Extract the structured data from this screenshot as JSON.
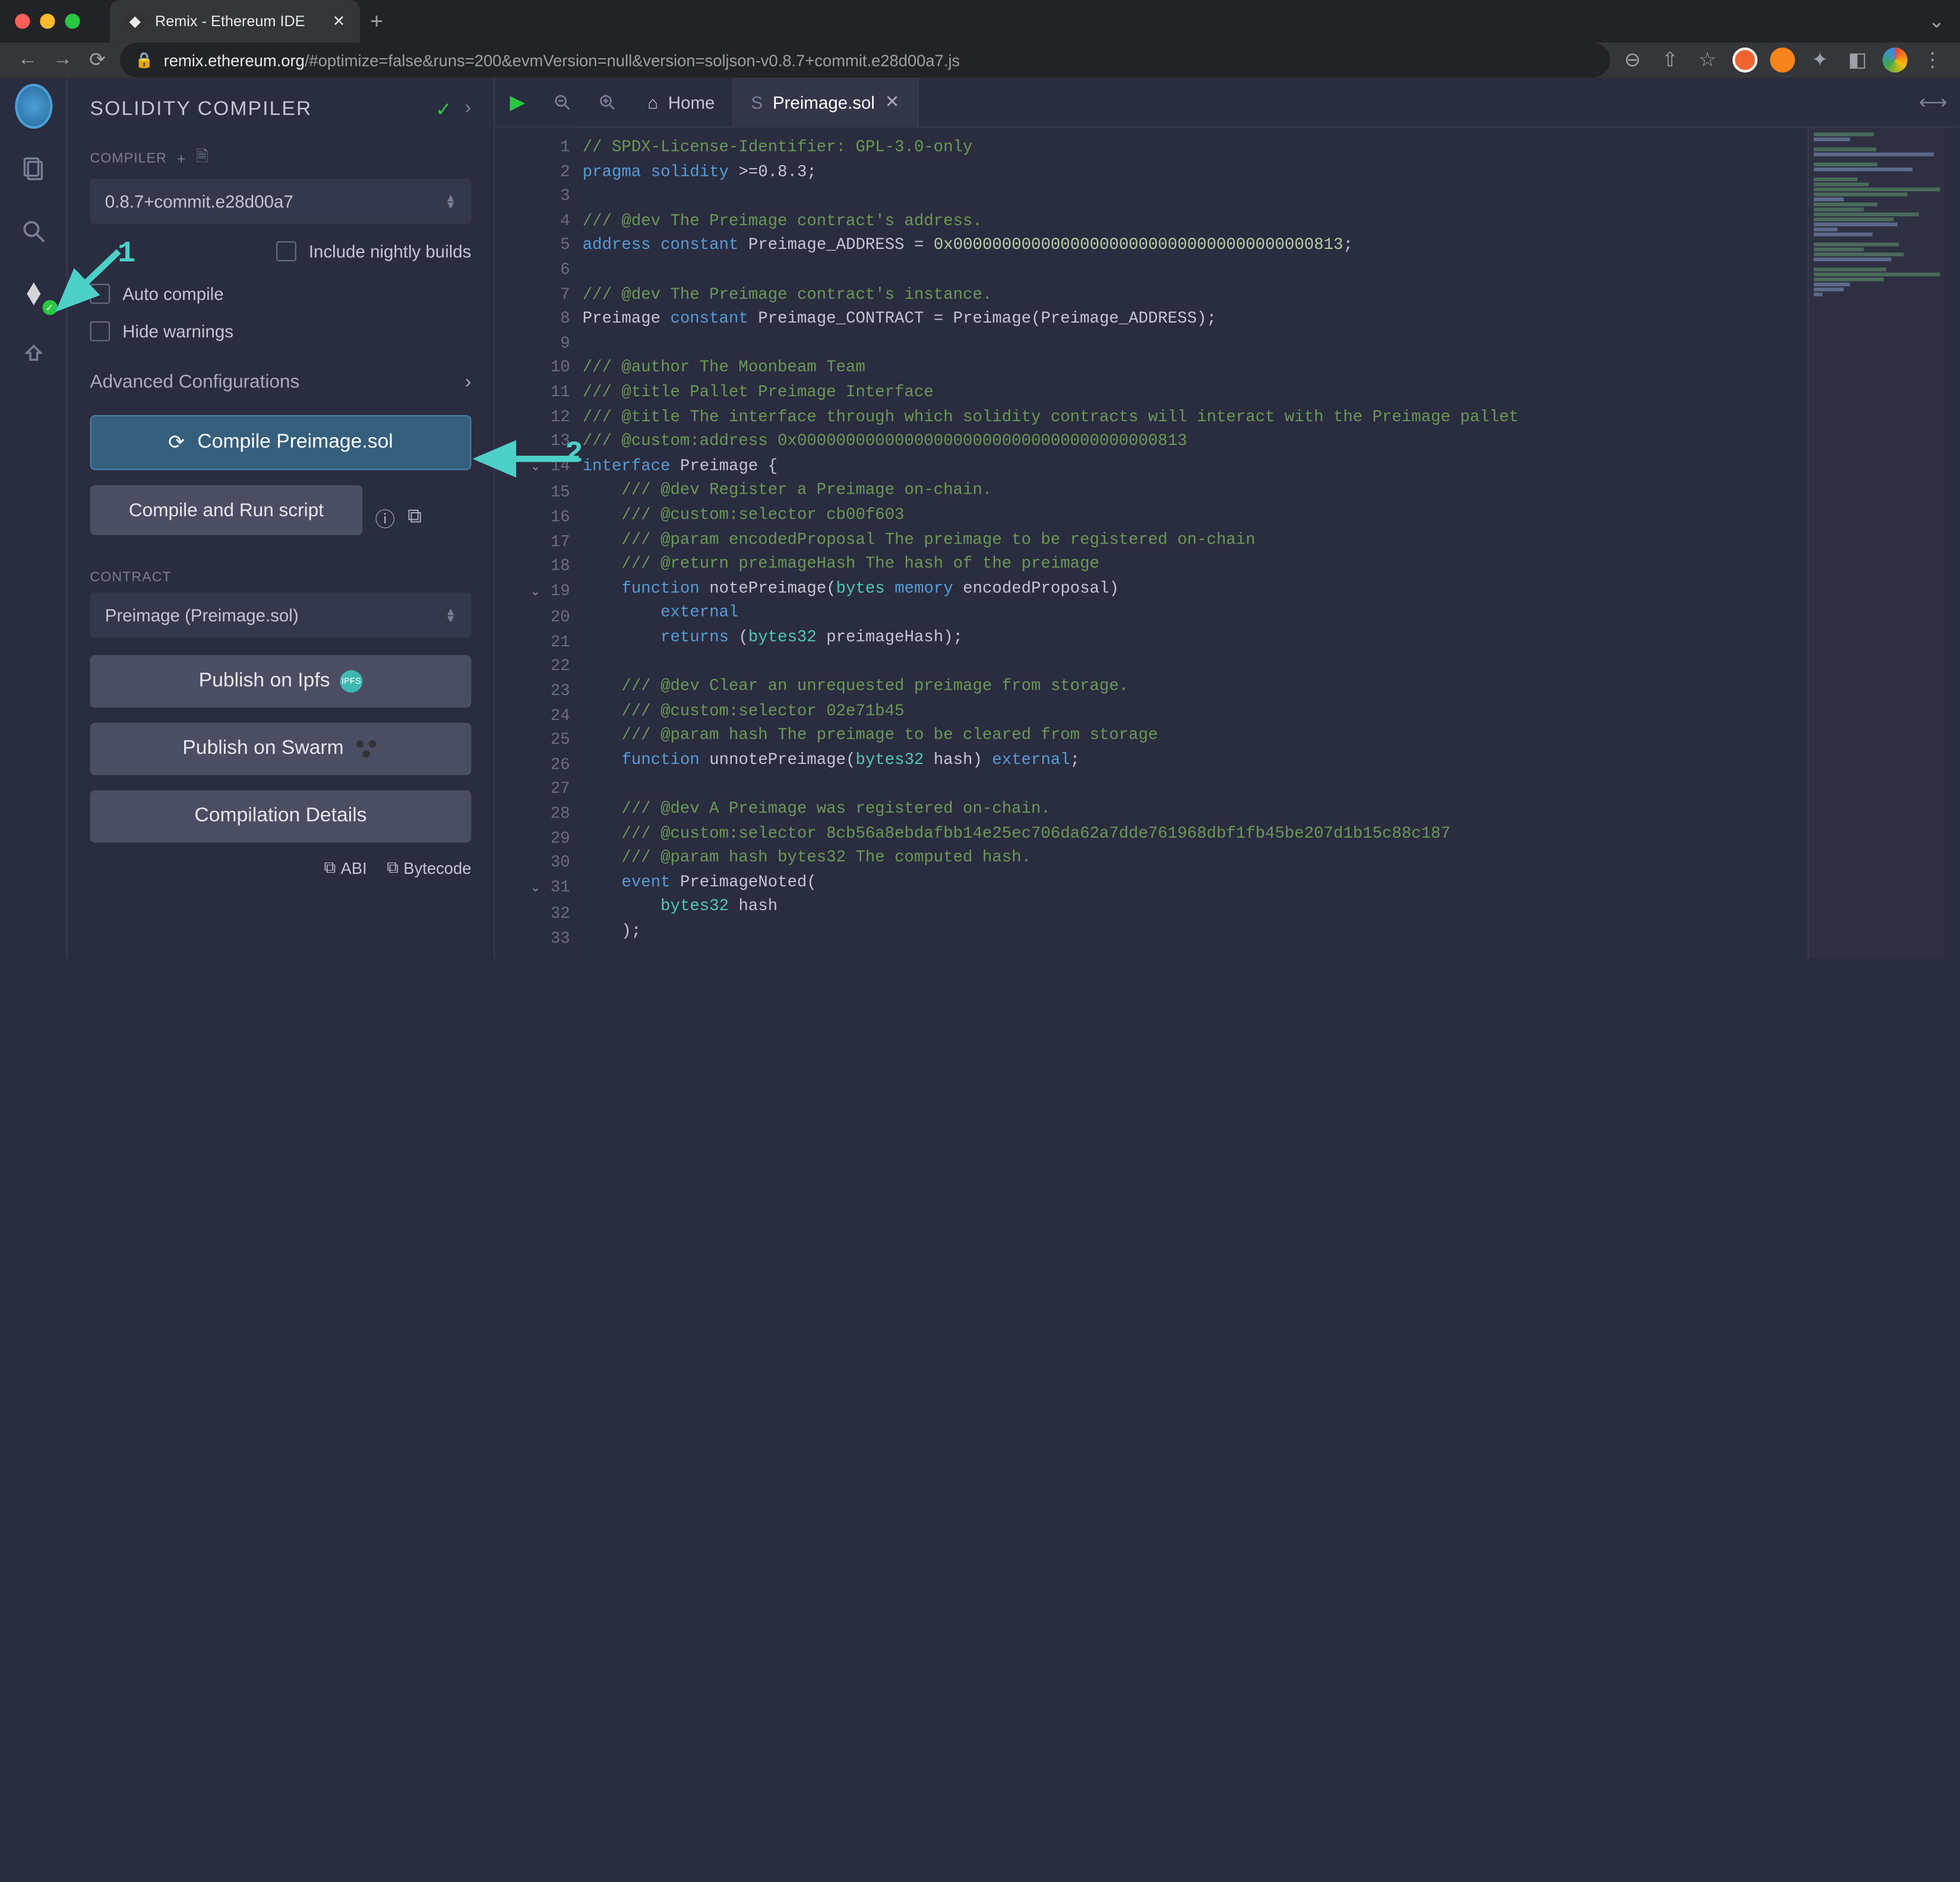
{
  "browser": {
    "tab_title": "Remix - Ethereum IDE",
    "url_host": "remix.ethereum.org",
    "url_path": "/#optimize=false&runs=200&evmVersion=null&version=soljson-v0.8.7+commit.e28d00a7.js"
  },
  "iconbar": {
    "items": [
      "remix-logo",
      "file-explorer-icon",
      "search-icon",
      "solidity-compiler-icon",
      "deploy-icon"
    ]
  },
  "panel": {
    "title": "SOLIDITY COMPILER",
    "compiler_label": "COMPILER",
    "compiler_version": "0.8.7+commit.e28d00a7",
    "include_nightly": "Include nightly builds",
    "auto_compile": "Auto compile",
    "hide_warnings": "Hide warnings",
    "advanced": "Advanced Configurations",
    "compile_btn": "Compile Preimage.sol",
    "compile_run_btn": "Compile and Run script",
    "contract_label": "CONTRACT",
    "contract_selected": "Preimage (Preimage.sol)",
    "publish_ipfs": "Publish on Ipfs",
    "publish_swarm": "Publish on Swarm",
    "compilation_details": "Compilation Details",
    "abi_link": "ABI",
    "bytecode_link": "Bytecode"
  },
  "tabs": {
    "home": "Home",
    "file": "Preimage.sol"
  },
  "annotations": {
    "marker1": "1",
    "marker2": "2"
  },
  "code": {
    "lines": [
      {
        "n": 1,
        "segs": [
          {
            "t": "// SPDX-License-Identifier: GPL-3.0-only",
            "c": "c-comment"
          }
        ]
      },
      {
        "n": 2,
        "segs": [
          {
            "t": "pragma",
            "c": "c-keyword"
          },
          {
            "t": " "
          },
          {
            "t": "solidity",
            "c": "c-keyword"
          },
          {
            "t": " >=0.8.3;"
          }
        ]
      },
      {
        "n": 3,
        "segs": [
          {
            "t": ""
          }
        ]
      },
      {
        "n": 4,
        "segs": [
          {
            "t": "/// @dev The Preimage contract's address.",
            "c": "c-comment"
          }
        ]
      },
      {
        "n": 5,
        "segs": [
          {
            "t": "address",
            "c": "c-keyword"
          },
          {
            "t": " "
          },
          {
            "t": "constant",
            "c": "c-keyword"
          },
          {
            "t": " Preimage_ADDRESS = "
          },
          {
            "t": "0x0000000000000000000000000000000000000813",
            "c": "c-number"
          },
          {
            "t": ";"
          }
        ]
      },
      {
        "n": 6,
        "segs": [
          {
            "t": ""
          }
        ]
      },
      {
        "n": 7,
        "segs": [
          {
            "t": "/// @dev The Preimage contract's instance.",
            "c": "c-comment"
          }
        ]
      },
      {
        "n": 8,
        "segs": [
          {
            "t": "Preimage "
          },
          {
            "t": "constant",
            "c": "c-keyword"
          },
          {
            "t": " Preimage_CONTRACT = Preimage(Preimage_ADDRESS);"
          }
        ]
      },
      {
        "n": 9,
        "segs": [
          {
            "t": ""
          }
        ]
      },
      {
        "n": 10,
        "segs": [
          {
            "t": "/// @author The Moonbeam Team",
            "c": "c-comment"
          }
        ]
      },
      {
        "n": 11,
        "segs": [
          {
            "t": "/// @title Pallet Preimage Interface",
            "c": "c-comment"
          }
        ]
      },
      {
        "n": 12,
        "segs": [
          {
            "t": "/// @title The interface through which solidity contracts will interact with the Preimage pallet",
            "c": "c-comment"
          }
        ]
      },
      {
        "n": 13,
        "segs": [
          {
            "t": "/// @custom:address 0x0000000000000000000000000000000000000813",
            "c": "c-comment"
          }
        ]
      },
      {
        "n": 14,
        "fold": true,
        "segs": [
          {
            "t": "interface",
            "c": "c-keyword"
          },
          {
            "t": " Preimage {"
          }
        ]
      },
      {
        "n": 15,
        "segs": [
          {
            "t": "    /// @dev Register a Preimage on-chain.",
            "c": "c-comment"
          }
        ]
      },
      {
        "n": 16,
        "segs": [
          {
            "t": "    /// @custom:selector cb00f603",
            "c": "c-comment"
          }
        ]
      },
      {
        "n": 17,
        "segs": [
          {
            "t": "    /// @param encodedProposal The preimage to be registered on-chain",
            "c": "c-comment"
          }
        ]
      },
      {
        "n": 18,
        "segs": [
          {
            "t": "    /// @return preimageHash The hash of the preimage",
            "c": "c-comment"
          }
        ]
      },
      {
        "n": 19,
        "fold": true,
        "segs": [
          {
            "t": "    "
          },
          {
            "t": "function",
            "c": "c-keyword"
          },
          {
            "t": " notePreimage("
          },
          {
            "t": "bytes",
            "c": "c-type"
          },
          {
            "t": " "
          },
          {
            "t": "memory",
            "c": "c-keyword"
          },
          {
            "t": " encodedProposal)"
          }
        ]
      },
      {
        "n": 20,
        "segs": [
          {
            "t": "        "
          },
          {
            "t": "external",
            "c": "c-keyword"
          }
        ]
      },
      {
        "n": 21,
        "segs": [
          {
            "t": "        "
          },
          {
            "t": "returns",
            "c": "c-keyword"
          },
          {
            "t": " ("
          },
          {
            "t": "bytes32",
            "c": "c-type"
          },
          {
            "t": " preimageHash);"
          }
        ]
      },
      {
        "n": 22,
        "segs": [
          {
            "t": ""
          }
        ]
      },
      {
        "n": 23,
        "segs": [
          {
            "t": "    /// @dev Clear an unrequested preimage from storage.",
            "c": "c-comment"
          }
        ]
      },
      {
        "n": 24,
        "segs": [
          {
            "t": "    /// @custom:selector 02e71b45",
            "c": "c-comment"
          }
        ]
      },
      {
        "n": 25,
        "segs": [
          {
            "t": "    /// @param hash The preimage to be cleared from storage",
            "c": "c-comment"
          }
        ]
      },
      {
        "n": 26,
        "segs": [
          {
            "t": "    "
          },
          {
            "t": "function",
            "c": "c-keyword"
          },
          {
            "t": " unnotePreimage("
          },
          {
            "t": "bytes32",
            "c": "c-type"
          },
          {
            "t": " hash) "
          },
          {
            "t": "external",
            "c": "c-keyword"
          },
          {
            "t": ";"
          }
        ]
      },
      {
        "n": 27,
        "segs": [
          {
            "t": ""
          }
        ]
      },
      {
        "n": 28,
        "segs": [
          {
            "t": "    /// @dev A Preimage was registered on-chain.",
            "c": "c-comment"
          }
        ]
      },
      {
        "n": 29,
        "segs": [
          {
            "t": "    /// @custom:selector 8cb56a8ebdafbb14e25ec706da62a7dde761968dbf1fb45be207d1b15c88c187",
            "c": "c-comment"
          }
        ]
      },
      {
        "n": 30,
        "segs": [
          {
            "t": "    /// @param hash bytes32 The computed hash.",
            "c": "c-comment"
          }
        ]
      },
      {
        "n": 31,
        "fold": true,
        "segs": [
          {
            "t": "    "
          },
          {
            "t": "event",
            "c": "c-keyword"
          },
          {
            "t": " PreimageNoted("
          }
        ]
      },
      {
        "n": 32,
        "segs": [
          {
            "t": "        "
          },
          {
            "t": "bytes32",
            "c": "c-type"
          },
          {
            "t": " hash"
          }
        ]
      },
      {
        "n": 33,
        "segs": [
          {
            "t": "    );"
          }
        ]
      }
    ]
  }
}
